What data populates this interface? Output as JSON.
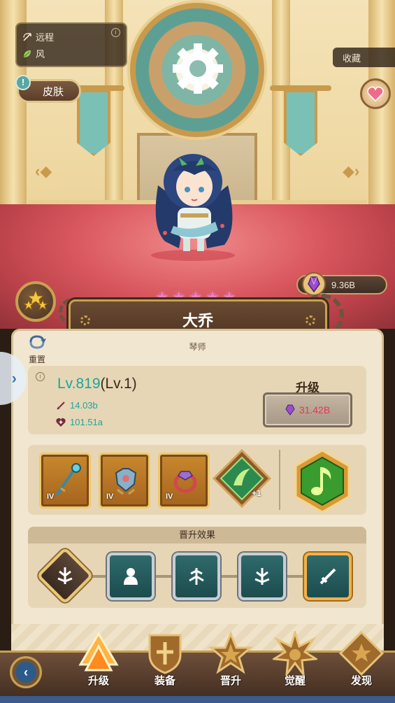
{
  "hero_info": {
    "attack_type": "远程",
    "element": "风"
  },
  "collect_label": "收藏",
  "skin_label": "皮肤",
  "currency": {
    "amount": "9.36B",
    "icon": "purple-gem-icon"
  },
  "hero": {
    "name": "大乔",
    "class": "琴师",
    "star_count": 5,
    "level": "Lv.819",
    "sub_level": "(Lv.1)",
    "attack": "14.03b",
    "hp": "101.51a"
  },
  "reset_label": "重置",
  "upgrade": {
    "label": "升级",
    "cost": "31.42B"
  },
  "equipment": [
    {
      "name": "staff",
      "tier": "IV"
    },
    {
      "name": "armor",
      "tier": "IV"
    },
    {
      "name": "ring",
      "tier": "IV"
    }
  ],
  "rune": {
    "plus": "+1"
  },
  "promotion": {
    "title": "晋升效果"
  },
  "bottom_nav": [
    {
      "label": "升级",
      "icon": "upgrade-arrow-icon"
    },
    {
      "label": "装备",
      "icon": "shield-icon"
    },
    {
      "label": "晋升",
      "icon": "star-icon"
    },
    {
      "label": "觉醒",
      "icon": "starburst-icon"
    },
    {
      "label": "发现",
      "icon": "diamond-star-icon"
    }
  ],
  "colors": {
    "accent_teal": "#1aa79a",
    "cost_red": "#e03a4e",
    "star_pink": "#ff79c4",
    "gold_border": "#c9a04f"
  }
}
